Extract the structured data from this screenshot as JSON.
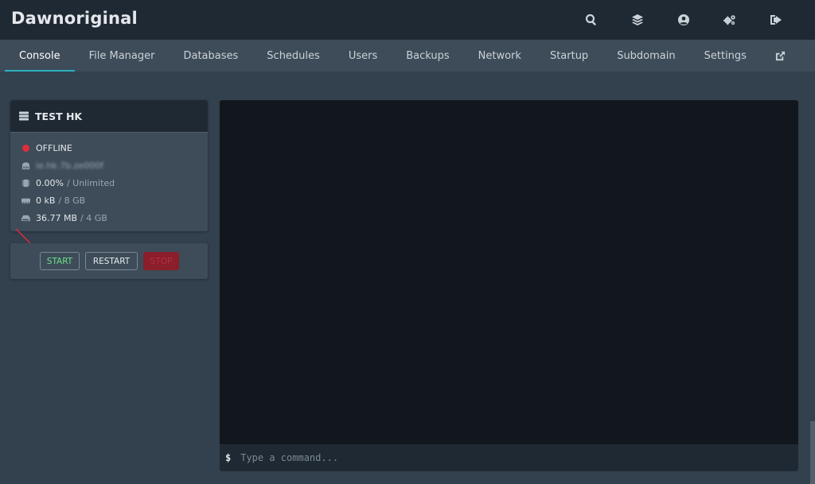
{
  "app": {
    "title": "Dawnoriginal"
  },
  "topbar": {
    "icons": [
      "search-icon",
      "layers-icon",
      "user-circle-icon",
      "cogs-icon",
      "sign-out-icon"
    ]
  },
  "nav": {
    "tabs": [
      {
        "label": "Console",
        "active": true
      },
      {
        "label": "File Manager"
      },
      {
        "label": "Databases"
      },
      {
        "label": "Schedules"
      },
      {
        "label": "Users"
      },
      {
        "label": "Backups"
      },
      {
        "label": "Network"
      },
      {
        "label": "Startup"
      },
      {
        "label": "Subdomain"
      },
      {
        "label": "Settings"
      }
    ],
    "external_icon": "external-link-icon"
  },
  "server": {
    "name": "TEST HK",
    "status": "OFFLINE",
    "status_color": "#e12d39",
    "address": "ie.hk.7b.ze000f",
    "cpu": {
      "value": "0.00%",
      "limit": "/ Unlimited"
    },
    "memory": {
      "value": "0 kB",
      "limit": "/ 8 GB"
    },
    "disk": {
      "value": "36.77 MB",
      "limit": "/ 4 GB"
    }
  },
  "power": {
    "start_label": "START",
    "restart_label": "RESTART",
    "stop_label": "STOP"
  },
  "console": {
    "prompt": "$",
    "placeholder": "Type a command..."
  },
  "colors": {
    "accent": "#2bb1c1",
    "start": "#6de08a",
    "stop": "#8a1e2a",
    "arrow": "#e12d39"
  }
}
